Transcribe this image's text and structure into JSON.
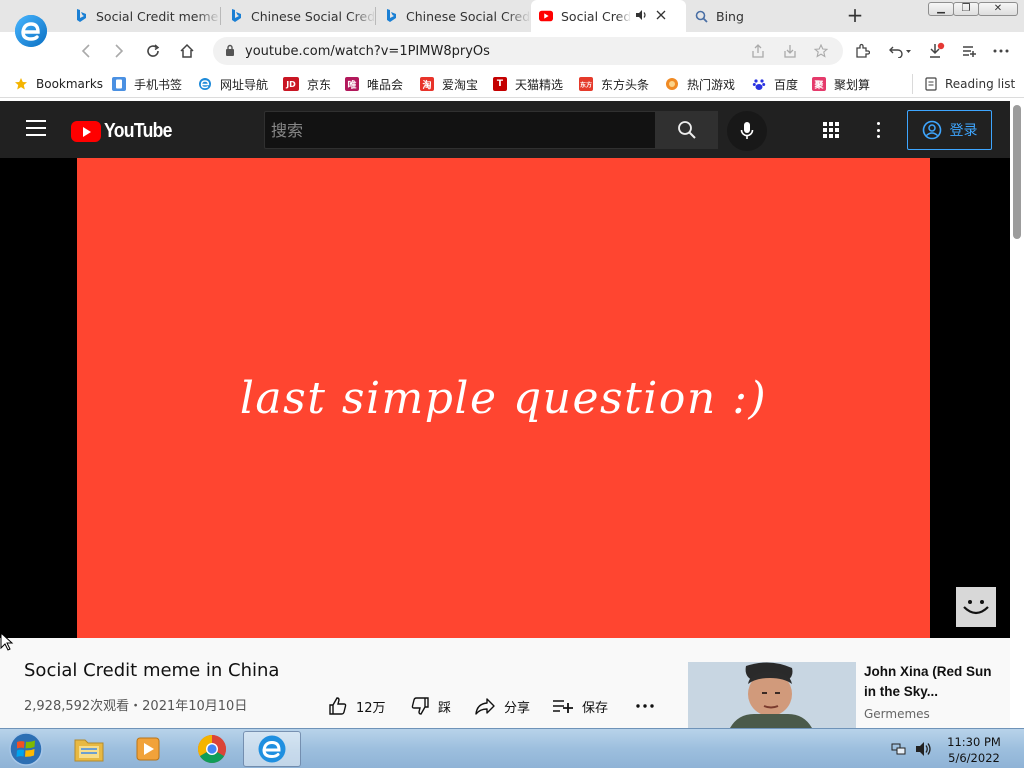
{
  "browser": {
    "tabs": [
      {
        "title": "Social Credit meme in China",
        "favicon": "bing-icon"
      },
      {
        "title": "Chinese Social Credit System",
        "favicon": "bing-icon"
      },
      {
        "title": "Chinese Social Credit",
        "favicon": "bing-icon"
      },
      {
        "title": "Social Credit meme",
        "favicon": "youtube-icon",
        "active": true,
        "audio": true
      },
      {
        "title": "Bing",
        "favicon": "search-icon"
      }
    ],
    "url": "youtube.com/watch?v=1PIMW8pryOs",
    "bookmarks": [
      {
        "label": "Bookmarks",
        "icon": "star-icon",
        "color": "#f4b400"
      },
      {
        "label": "手机书签",
        "icon": "phone-bookmark-icon",
        "color": "#4a90e2"
      },
      {
        "label": "网址导航",
        "icon": "ie-icon",
        "color": "#1d8ad9"
      },
      {
        "label": "京东",
        "icon": "jd-icon",
        "color": "#c91623",
        "glyph": "JD"
      },
      {
        "label": "唯品会",
        "icon": "vip-icon",
        "color": "#b2185b",
        "glyph": "唯"
      },
      {
        "label": "爱淘宝",
        "icon": "taobao-icon",
        "color": "#e8332a",
        "glyph": "淘"
      },
      {
        "label": "天猫精选",
        "icon": "tmall-icon",
        "color": "#c40000",
        "glyph": "T"
      },
      {
        "label": "东方头条",
        "icon": "dongfang-icon",
        "color": "#e53a2b",
        "glyph": "东方"
      },
      {
        "label": "热门游戏",
        "icon": "games-icon",
        "color": "#f08a24"
      },
      {
        "label": "百度",
        "icon": "baidu-icon",
        "color": "#2932e1"
      },
      {
        "label": "聚划算",
        "icon": "juhuasuan-icon",
        "color": "#e53a6b",
        "glyph": "聚"
      }
    ],
    "reading_list": "Reading list"
  },
  "youtube": {
    "logo_text": "YouTube",
    "search_placeholder": "搜索",
    "signin_label": "登录",
    "video_caption": "last simple question :)",
    "video_title": "Social Credit meme in China",
    "video_stats": "2,928,592次观看・2021年10月10日",
    "actions": {
      "like": "12万",
      "dislike": "踩",
      "share": "分享",
      "save": "保存"
    },
    "recommended": {
      "title": "John Xina (Red Sun in the Sky...",
      "channel": "Germemes"
    }
  },
  "taskbar": {
    "time": "11:30 PM",
    "date": "5/6/2022"
  }
}
